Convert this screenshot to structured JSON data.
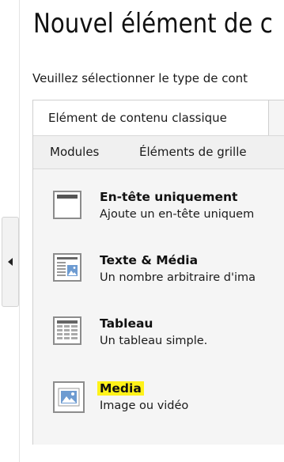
{
  "page": {
    "title": "Nouvel élément de c",
    "intro": "Veuillez sélectionner le type de cont"
  },
  "tabs": {
    "main_label": "Elément de contenu classique",
    "sub_items": [
      "Modules",
      "Éléments de grille"
    ]
  },
  "content_types": [
    {
      "icon": "header-only-icon",
      "title": "En-tête uniquement",
      "description": "Ajoute un en-tête uniquem"
    },
    {
      "icon": "text-media-icon",
      "title": "Texte & Média",
      "description": "Un nombre arbitraire d'ima"
    },
    {
      "icon": "table-icon",
      "title": "Tableau",
      "description": "Un tableau simple."
    },
    {
      "icon": "media-image-icon",
      "title": "Media",
      "description": "Image ou vidéo",
      "highlighted": true
    }
  ],
  "colors": {
    "highlight": "#fff21a",
    "icon_border": "#8c8c8c",
    "icon_blue": "#6d9bd1",
    "panel_bg": "#f5f5f5"
  }
}
